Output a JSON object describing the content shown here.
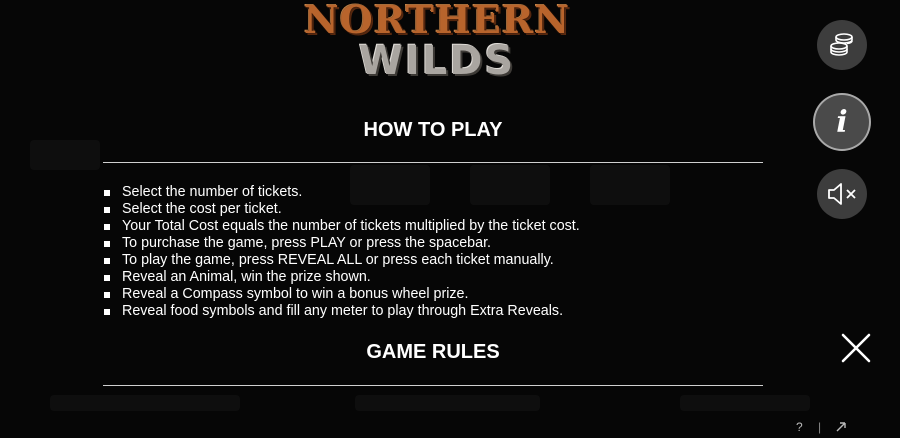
{
  "logo": {
    "line1": "NORTHERN",
    "line2": "WILDS"
  },
  "how_to_play": {
    "title": "HOW TO PLAY",
    "items": [
      "Select the number of tickets.",
      "Select the cost per ticket.",
      "Your Total Cost equals the number of tickets multiplied by the ticket cost.",
      "To purchase the game, press PLAY or press the spacebar.",
      "To play the game, press REVEAL ALL or press each ticket manually.",
      "Reveal an Animal, win the prize shown.",
      "Reveal a Compass symbol to win a bonus wheel prize.",
      "Reveal food symbols and fill any meter to play through Extra Reveals."
    ]
  },
  "game_rules": {
    "title": "GAME RULES"
  },
  "side_buttons": {
    "chips": "coin-stack-icon",
    "info": "i",
    "sound": "speaker-muted-icon"
  },
  "close": "close-icon",
  "footer": {
    "help": "?",
    "separator": "|"
  },
  "colors": {
    "background": "#060606",
    "text": "#ffffff",
    "logo_copper": "#b8642c",
    "logo_stone": "#a9a5a0",
    "button": "#3d3d3d"
  }
}
